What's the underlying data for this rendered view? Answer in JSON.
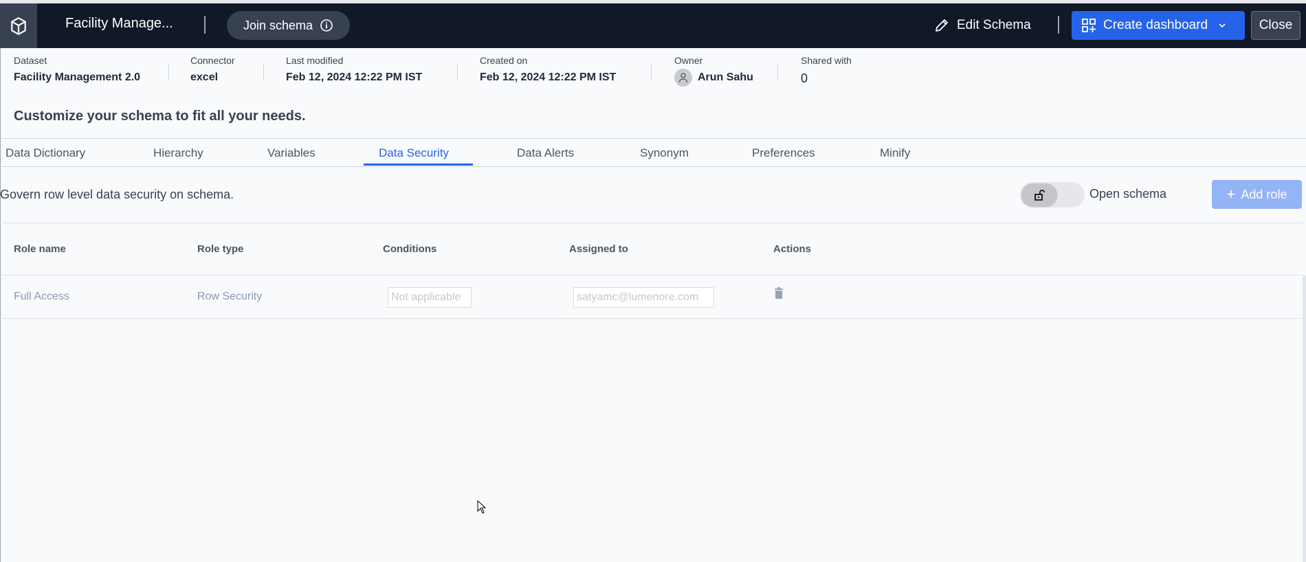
{
  "header": {
    "title": "Facility Manage...",
    "join_schema": "Join schema",
    "edit_schema": "Edit Schema",
    "create_dashboard": "Create dashboard",
    "close": "Close"
  },
  "meta": [
    {
      "label": "Dataset",
      "value": "Facility Management 2.0"
    },
    {
      "label": "Connector",
      "value": "excel"
    },
    {
      "label": "Last modified",
      "value": "Feb 12, 2024 12:22 PM IST"
    },
    {
      "label": "Created on",
      "value": "Feb 12, 2024 12:22 PM IST"
    },
    {
      "label": "Owner",
      "value": "Arun Sahu"
    },
    {
      "label": "Shared with",
      "value": "0"
    }
  ],
  "heading": "Customize your schema to fit all your needs.",
  "tabs": [
    "Data Dictionary",
    "Hierarchy",
    "Variables",
    "Data Security",
    "Data Alerts",
    "Synonym",
    "Preferences",
    "Minify"
  ],
  "active_tab": "Data Security",
  "security": {
    "description": "Govern row level data security on schema.",
    "toggle_label": "Open schema",
    "add_role": "Add role"
  },
  "table": {
    "headers": [
      "Role name",
      "Role type",
      "Conditions",
      "Assigned to",
      "Actions"
    ],
    "rows": [
      {
        "role_name": "Full Access",
        "role_type": "Row Security",
        "conditions": "Not applicable",
        "assigned_to": "satyamc@lumenore.com"
      }
    ]
  },
  "colors": {
    "header_bg": "#111827",
    "accent": "#2563eb"
  }
}
